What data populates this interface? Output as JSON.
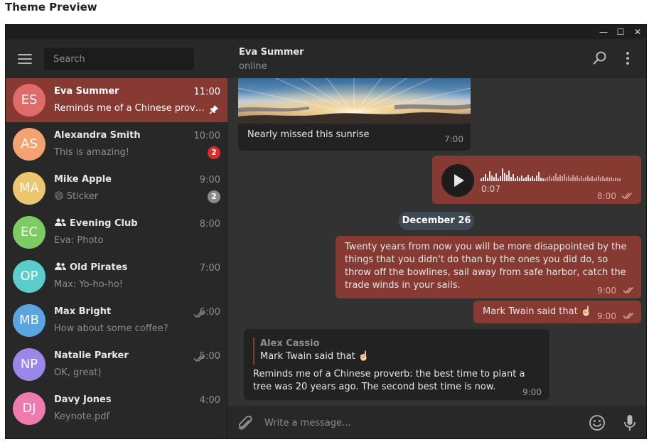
{
  "page_title": "Theme Preview",
  "window": {
    "minimize": "—",
    "maximize": "☐",
    "close": "✕"
  },
  "sidebar": {
    "search_placeholder": "Search",
    "chats": [
      {
        "initials": "ES",
        "name": "Eva Summer",
        "time": "11:00",
        "preview": "Reminds me of a Chinese proverb: the best time to plant a tree",
        "avatar_color": "#e06b6b",
        "active": true,
        "pinned": true
      },
      {
        "initials": "AS",
        "name": "Alexandra Smith",
        "time": "10:00",
        "preview": "This is amazing!",
        "avatar_color": "#f3a270",
        "badge": "2",
        "badge_color": "#e02a2a"
      },
      {
        "initials": "MA",
        "name": "Mike Apple",
        "time": "9:00",
        "preview_emoji": "😄",
        "preview": "Sticker",
        "avatar_color": "#edc672",
        "badge": "2",
        "badge_color": "#8a8a8a"
      },
      {
        "initials": "EC",
        "name": "Evening Club",
        "time": "8:00",
        "preview": "Eva: Photo",
        "avatar_color": "#7ccc63",
        "group": true
      },
      {
        "initials": "OP",
        "name": "Old Pirates",
        "time": "7:00",
        "preview": "Max: Yo-ho-ho!",
        "avatar_color": "#5ccdcd",
        "group": true
      },
      {
        "initials": "MB",
        "name": "Max Bright",
        "time": "6:00",
        "preview": "How about some coffee?",
        "avatar_color": "#5aa4e0",
        "read": true
      },
      {
        "initials": "NP",
        "name": "Natalie Parker",
        "time": "5:00",
        "preview": "OK, great)",
        "avatar_color": "#9a87e8",
        "read": true
      },
      {
        "initials": "DJ",
        "name": "Davy Jones",
        "time": "4:00",
        "preview": "Keynote.pdf",
        "avatar_color": "#ef7aae"
      }
    ]
  },
  "chat": {
    "peer_name": "Eva Summer",
    "peer_status": "online",
    "messages": {
      "photo_caption": "Nearly missed this sunrise",
      "photo_time": "7:00",
      "voice_duration": "0:07",
      "voice_time": "8:00",
      "date_separator": "December 26",
      "quote_text": "Twenty years from now you will be more disappointed by the things that you didn't do than by the ones you did do, so throw off the bowlines, sail away from safe harbor, catch the trade winds in your sails.",
      "quote_time": "9:00",
      "attribution_text": "Mark Twain said that ☝🏻",
      "attribution_time": "9:00",
      "reply_author": "Alex Cassio",
      "reply_quote": "Mark Twain said that ☝🏻",
      "reply_text": "Reminds me of a Chinese proverb: the best time to plant a tree was 20 years ago. The second best time is now.",
      "reply_time": "9:00"
    },
    "composer_placeholder": "Write a message..."
  },
  "colors": {
    "accent": "#863a32",
    "background": "#323232",
    "sidebar": "#282828",
    "date_pill": "#3f4a55"
  },
  "icons": [
    "menu-icon",
    "search-icon",
    "more-vertical-icon",
    "attach-icon",
    "emoji-icon",
    "mic-icon",
    "pin-icon",
    "group-icon",
    "double-check-icon",
    "play-icon"
  ]
}
